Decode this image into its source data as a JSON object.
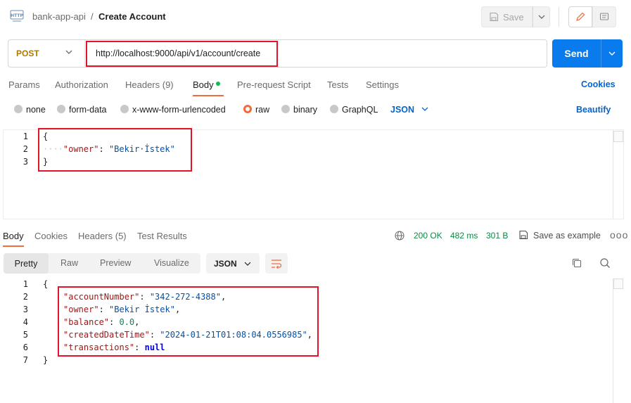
{
  "header": {
    "collection": "bank-app-api",
    "separator": "/",
    "request_name": "Create Account",
    "save_label": "Save",
    "http_icon_text": "HTTP"
  },
  "url_bar": {
    "method": "POST",
    "url": "http://localhost:9000/api/v1/account/create",
    "send_label": "Send"
  },
  "request_tabs": [
    {
      "label": "Params"
    },
    {
      "label": "Authorization"
    },
    {
      "label": "Headers (9)"
    },
    {
      "label": "Body",
      "active": true
    },
    {
      "label": "Pre-request Script"
    },
    {
      "label": "Tests"
    },
    {
      "label": "Settings"
    }
  ],
  "cookies_label": "Cookies",
  "body_types": [
    {
      "label": "none"
    },
    {
      "label": "form-data"
    },
    {
      "label": "x-www-form-urlencoded"
    },
    {
      "label": "raw",
      "selected": true
    },
    {
      "label": "binary"
    },
    {
      "label": "GraphQL"
    }
  ],
  "body_format": "JSON",
  "beautify_label": "Beautify",
  "request_body": {
    "line_numbers": [
      "1",
      "2",
      "3"
    ],
    "open_brace": "{",
    "close_brace": "}",
    "key": "\"owner\"",
    "colon": ": ",
    "value": "\"Bekir·İstek\"",
    "indent": "····"
  },
  "response_tabs": [
    {
      "label": "Body",
      "active": true
    },
    {
      "label": "Cookies"
    },
    {
      "label": "Headers (5)"
    },
    {
      "label": "Test Results"
    }
  ],
  "response_status": {
    "status": "200 OK",
    "time": "482 ms",
    "size": "301 B",
    "save_example": "Save as example",
    "more": "ooo"
  },
  "response_views": {
    "pretty": "Pretty",
    "raw": "Raw",
    "preview": "Preview",
    "visualize": "Visualize",
    "format": "JSON"
  },
  "response_body": {
    "line_numbers": [
      "1",
      "2",
      "3",
      "4",
      "5",
      "6",
      "7"
    ],
    "open_brace": "{",
    "close_brace": "}",
    "fields": [
      {
        "key": "\"accountNumber\"",
        "value": "\"342-272-4388\"",
        "type": "str",
        "comma": ","
      },
      {
        "key": "\"owner\"",
        "value": "\"Bekir İstek\"",
        "type": "str",
        "comma": ","
      },
      {
        "key": "\"balance\"",
        "value": "0.0",
        "type": "num",
        "comma": ","
      },
      {
        "key": "\"createdDateTime\"",
        "value": "\"2024-01-21T01:08:04.0556985\"",
        "type": "str",
        "comma": ","
      },
      {
        "key": "\"transactions\"",
        "value": "null",
        "type": "kw",
        "comma": ""
      }
    ]
  },
  "colors": {
    "accent_orange": "#f26b3a",
    "send_blue": "#097bed",
    "link_blue": "#0265d2",
    "status_green": "#0c8a43",
    "highlight_red": "#e0142a"
  }
}
